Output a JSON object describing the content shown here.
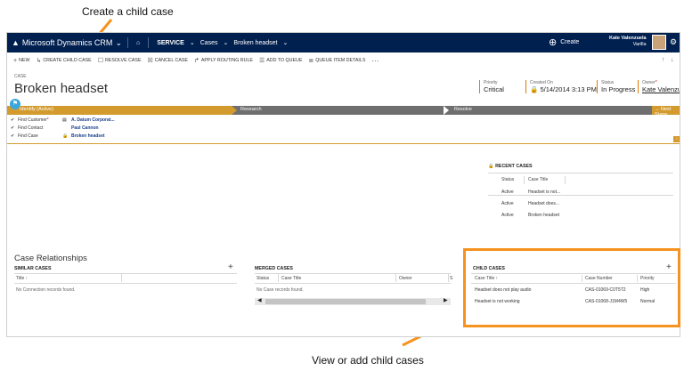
{
  "annotations": {
    "top": "Create a child case",
    "bottom": "View or add child cases"
  },
  "nav": {
    "brand": "Microsoft Dynamics CRM",
    "module": "SERVICE",
    "entity": "Cases",
    "record": "Broken headset",
    "create_label": "Create",
    "user_name": "Kate Valenzuela",
    "user_org": "Varilla"
  },
  "commands": [
    {
      "label": "NEW",
      "icon": "plus-icon"
    },
    {
      "label": "CREATE CHILD CASE",
      "icon": "child-case-icon"
    },
    {
      "label": "RESOLVE CASE",
      "icon": "resolve-icon"
    },
    {
      "label": "CANCEL CASE",
      "icon": "cancel-icon"
    },
    {
      "label": "APPLY ROUTING RULE",
      "icon": "routing-icon"
    },
    {
      "label": "ADD TO QUEUE",
      "icon": "queue-icon"
    },
    {
      "label": "QUEUE ITEM DETAILS",
      "icon": "queue-details-icon"
    },
    {
      "label": "···",
      "icon": "more-icon"
    }
  ],
  "record": {
    "entity_label": "CASE",
    "title": "Broken headset",
    "priority_label": "Priority",
    "priority": "Critical",
    "created_label": "Created On",
    "created": "5/14/2014  3:13 PM",
    "status_label": "Status",
    "status": "In Progress",
    "owner_label": "Owner",
    "owner": "Kate Valenzue"
  },
  "process": {
    "stages": [
      "Identify (Active)",
      "Research",
      "Resolve"
    ],
    "next_stage": "Next Stage",
    "steps": [
      {
        "name": "Find Customer",
        "required": "*",
        "value": "A. Datum Corporat..."
      },
      {
        "name": "Find Contact",
        "required": "",
        "value": "Paul Cannon"
      },
      {
        "name": "Find Case",
        "required": "",
        "value": "Broken headset"
      }
    ]
  },
  "recent_cases": {
    "title": "RECENT CASES",
    "headers": [
      "Status",
      "Case Title"
    ],
    "rows": [
      [
        "Active",
        "Headset is not..."
      ],
      [
        "Active",
        "Headset does..."
      ],
      [
        "Active",
        "Broken headset"
      ]
    ]
  },
  "relationships": {
    "title": "Case Relationships",
    "similar": {
      "title": "SIMILAR CASES",
      "header": "Title",
      "empty": "No Connection records found."
    },
    "merged": {
      "title": "MERGED CASES",
      "headers": [
        "Status",
        "Case Title",
        "Owner",
        "S"
      ],
      "empty": "No Case records found."
    },
    "child": {
      "title": "CHILD CASES",
      "headers": [
        "Case Title",
        "Case Number",
        "Priority"
      ],
      "rows": [
        [
          "Headset does not play audio",
          "CAS-01069-C0T5T2",
          "High"
        ],
        [
          "Headset is not working",
          "CAS-01068-J1M4W5",
          "Normal"
        ]
      ]
    }
  }
}
